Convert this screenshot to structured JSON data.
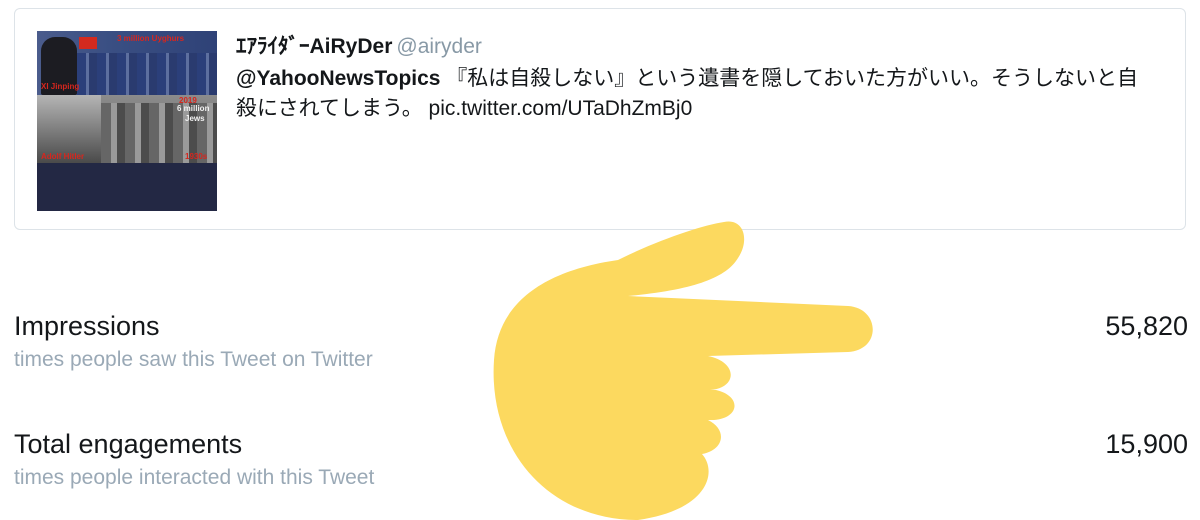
{
  "tweet": {
    "author_name": "ｴｱﾗｲﾀﾞｰAiRyDer",
    "author_handle": "@airyder",
    "mention": "@YahooNewsTopics",
    "text": " 『私は自殺しない』という遺書を隠しておいた方がいい。そうしないと自殺にされてしまう。 ",
    "pic_link": "pic.twitter.com/UTaDhZmBj0",
    "thumbnail": {
      "captions": [
        "3 million Uyghurs",
        "XI Jinping",
        "2019",
        "6 million",
        "Jews",
        "Adolf Hitler",
        "1930s"
      ]
    }
  },
  "metrics": [
    {
      "title": "Impressions",
      "subtitle": "times people saw this Tweet on Twitter",
      "value": "55,820"
    },
    {
      "title": "Total engagements",
      "subtitle": "times people interacted with this Tweet",
      "value": "15,900"
    }
  ],
  "overlay": {
    "icon": "pointing-hand-emoji",
    "color": "#fcd95f"
  }
}
